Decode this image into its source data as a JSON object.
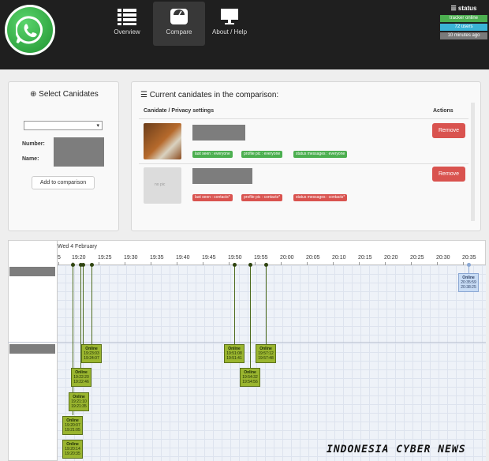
{
  "nav": {
    "items": [
      {
        "label": "Overview",
        "icon": "list-icon"
      },
      {
        "label": "Compare",
        "icon": "scale-icon"
      },
      {
        "label": "About / Help",
        "icon": "monitor-icon"
      }
    ],
    "status": {
      "title": "status",
      "tracker": "tracker online",
      "users": "72 users",
      "updated": "10 minutes ago"
    }
  },
  "select_panel": {
    "title": "Select Canidates",
    "number_label": "Number:",
    "name_label": "Name:",
    "add_button": "Add to comparison"
  },
  "comparison_panel": {
    "title": "Current canidates in the comparison:",
    "col_candidate": "Canidate / Privacy settings",
    "col_actions": "Actions",
    "rows": [
      {
        "tags": [
          "last seen : everyone",
          "profile pic : everyone",
          "status messages : everyone"
        ],
        "remove": "Remove"
      },
      {
        "avatar_text": "no pic",
        "tags": [
          "last seen : contacts*",
          "profile pic : contacts*",
          "status messages : contacts*"
        ],
        "remove": "Remove"
      }
    ]
  },
  "timeline": {
    "date": "Wed 4 February",
    "ticks": [
      "5",
      "19:20",
      "19:25",
      "19:30",
      "19:35",
      "19:40",
      "19:45",
      "19:50",
      "19:55",
      "20:00",
      "20:05",
      "20:10",
      "20:15",
      "20:20",
      "20:25",
      "20:30",
      "20:35"
    ],
    "events": [
      {
        "label": "Online",
        "start": "20:35:59",
        "end": "20:38:25"
      },
      {
        "label": "Online",
        "start": "19:23:03",
        "end": "19:24:07"
      },
      {
        "label": "Online",
        "start": "19:51:08",
        "end": "19:51:41"
      },
      {
        "label": "Online",
        "start": "19:57:12",
        "end": "19:57:48"
      },
      {
        "label": "Online",
        "start": "19:22:20",
        "end": "19:22:46"
      },
      {
        "label": "Online",
        "start": "19:54:32",
        "end": "19:54:56"
      },
      {
        "label": "Online",
        "start": "19:21:10",
        "end": "19:21:35"
      },
      {
        "label": "Online",
        "start": "19:20:07",
        "end": "19:21:05"
      },
      {
        "label": "Online",
        "start": "19:20:14",
        "end": "19:20:35"
      }
    ]
  },
  "watermark": "INDONESIA CYBER NEWS",
  "colors": {
    "accent_green": "#4caf50",
    "accent_red": "#d9534f",
    "event_green": "#9ab52f"
  }
}
